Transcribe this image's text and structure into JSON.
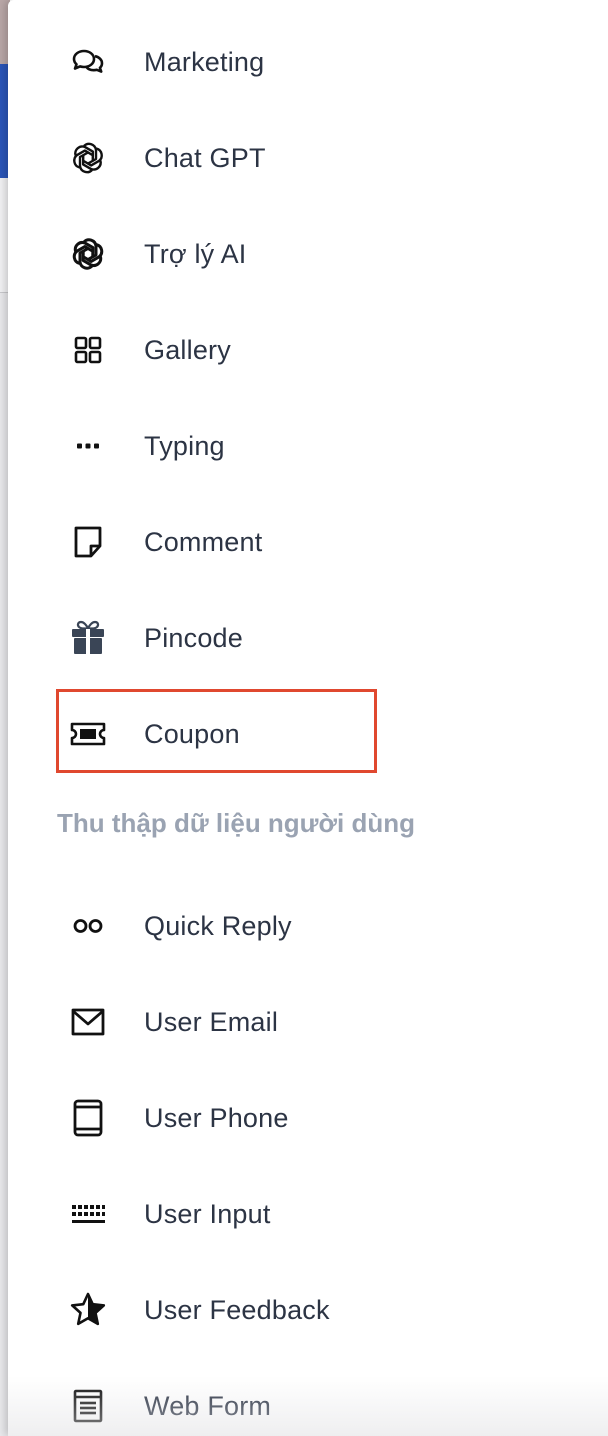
{
  "menu": {
    "items": [
      {
        "label": "Marketing",
        "icon": "chat-bubbles-icon"
      },
      {
        "label": "Chat GPT",
        "icon": "openai-icon"
      },
      {
        "label": "Trợ lý AI",
        "icon": "ai-assistant-icon"
      },
      {
        "label": "Gallery",
        "icon": "grid-icon"
      },
      {
        "label": "Typing",
        "icon": "ellipsis-icon"
      },
      {
        "label": "Comment",
        "icon": "note-icon"
      },
      {
        "label": "Pincode",
        "icon": "gift-icon"
      },
      {
        "label": "Coupon",
        "icon": "ticket-icon"
      }
    ],
    "section_title": "Thu thập dữ liệu người dùng",
    "user_items": [
      {
        "label": "Quick Reply",
        "icon": "two-circles-icon"
      },
      {
        "label": "User Email",
        "icon": "envelope-icon"
      },
      {
        "label": "User Phone",
        "icon": "tablet-icon"
      },
      {
        "label": "User Input",
        "icon": "keyboard-icon"
      },
      {
        "label": "User Feedback",
        "icon": "star-icon"
      },
      {
        "label": "Web Form",
        "icon": "form-icon"
      }
    ]
  },
  "colors": {
    "highlight_border": "#e0482f",
    "section_title": "#9aa3b2",
    "label_text": "#2c3444"
  }
}
